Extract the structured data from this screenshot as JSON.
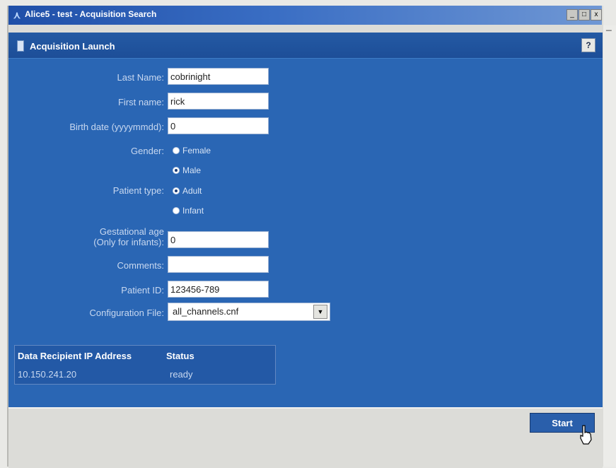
{
  "window": {
    "title": "Alice5 - test - Acquisition Search",
    "minimize": "_",
    "maximize": "□",
    "close": "x"
  },
  "panel": {
    "title": "Acquisition Launch",
    "help": "?"
  },
  "form": {
    "last_name_label": "Last Name:",
    "last_name_value": "cobrinight",
    "first_name_label": "First name:",
    "first_name_value": "rick",
    "birth_date_label": "Birth date (yyyymmdd):",
    "birth_date_value": "0",
    "gender_label": "Gender:",
    "gender_options": [
      "Female",
      "Male"
    ],
    "gender_selected": "Male",
    "patient_type_label": "Patient type:",
    "patient_type_options": [
      "Adult",
      "Infant"
    ],
    "patient_type_selected": "Adult",
    "gestational_age_label_line1": "Gestational age",
    "gestational_age_label_line2": "(Only for infants):",
    "gestational_age_value": "0",
    "comments_label": "Comments:",
    "comments_value": "",
    "patient_id_label": "Patient ID:",
    "patient_id_value": "123456-789",
    "config_file_label": "Configuration File:",
    "config_file_value": "all_channels.cnf"
  },
  "status_table": {
    "headers": [
      "Data Recipient IP Address",
      "Status"
    ],
    "rows": [
      [
        "10.150.241.20",
        "ready"
      ]
    ]
  },
  "footer": {
    "start_label": "Start"
  }
}
